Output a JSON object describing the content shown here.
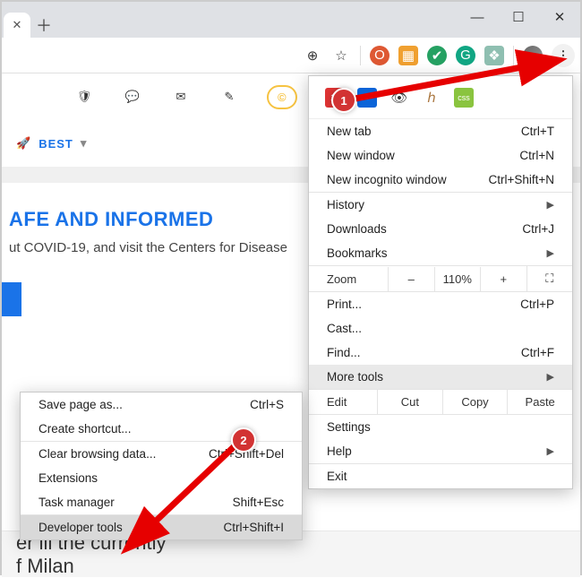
{
  "window_controls": {
    "min": "—",
    "max": "☐",
    "close": "✕"
  },
  "tab": {
    "close": "✕",
    "new": "＋"
  },
  "toolbar": {
    "zoom_icon": "⊕",
    "star_icon": "☆",
    "dots": "⋮"
  },
  "site": {
    "shield": "🛡",
    "chat": "💬",
    "mail": "✉",
    "pencil": "✎",
    "pill": "©"
  },
  "best": {
    "rocket": "🚀",
    "label": "BEST",
    "chev": "▾"
  },
  "headline": "AFE AND INFORMED",
  "subtext": "ut COVID-19, and visit the Centers for Disease",
  "bg_line1": "er ill the currently",
  "bg_line2": "f Milan",
  "menu": {
    "new_tab": {
      "label": "New tab",
      "kbd": "Ctrl+T"
    },
    "new_window": {
      "label": "New window",
      "kbd": "Ctrl+N"
    },
    "new_incognito": {
      "label": "New incognito window",
      "kbd": "Ctrl+Shift+N"
    },
    "history": {
      "label": "History"
    },
    "downloads": {
      "label": "Downloads",
      "kbd": "Ctrl+J"
    },
    "bookmarks": {
      "label": "Bookmarks"
    },
    "zoom": {
      "label": "Zoom",
      "minus": "–",
      "value": "110%",
      "plus": "+",
      "full": "⛶"
    },
    "print": {
      "label": "Print...",
      "kbd": "Ctrl+P"
    },
    "cast": {
      "label": "Cast..."
    },
    "find": {
      "label": "Find...",
      "kbd": "Ctrl+F"
    },
    "more_tools": {
      "label": "More tools"
    },
    "edit": {
      "label": "Edit",
      "cut": "Cut",
      "copy": "Copy",
      "paste": "Paste"
    },
    "settings": {
      "label": "Settings"
    },
    "help": {
      "label": "Help"
    },
    "exit": {
      "label": "Exit"
    }
  },
  "submenu": {
    "save_page": {
      "label": "Save page as...",
      "kbd": "Ctrl+S"
    },
    "create_shortcut": {
      "label": "Create shortcut..."
    },
    "clear_data": {
      "label": "Clear browsing data...",
      "kbd": "Ctrl+Shift+Del"
    },
    "extensions": {
      "label": "Extensions"
    },
    "task_manager": {
      "label": "Task manager",
      "kbd": "Shift+Esc"
    },
    "dev_tools": {
      "label": "Developer tools",
      "kbd": "Ctrl+Shift+I"
    }
  },
  "callout": {
    "one": "1",
    "two": "2"
  }
}
